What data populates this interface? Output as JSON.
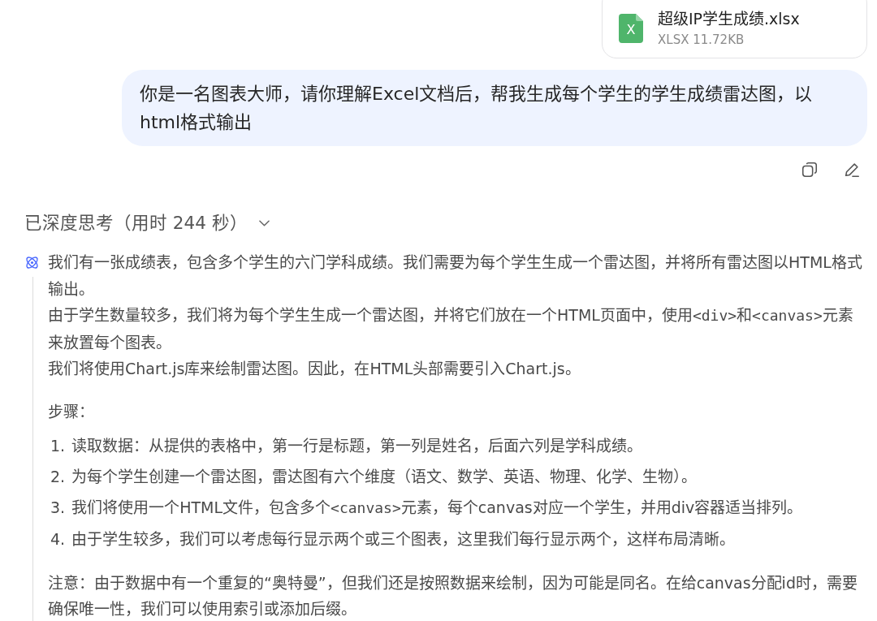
{
  "attachment": {
    "icon_letter": "X",
    "name": "超级IP学生成绩.xlsx",
    "meta": "XLSX 11.72KB"
  },
  "user_message": {
    "text": "你是一名图表大师，请你理解Excel文档后，帮我生成每个学生的学生成绩雷达图，以html格式输出"
  },
  "thinking": {
    "header": "已深度思考（用时 244 秒）",
    "expanded": true,
    "paragraphs": [
      {
        "segments": [
          {
            "kind": "text",
            "text": "我们有一张成绩表，包含多个学生的六门学科成绩。我们需要为每个学生生成一个雷达图，并将所有雷达图以HTML格式输出。"
          }
        ]
      },
      {
        "segments": [
          {
            "kind": "text",
            "text": "由于学生数量较多，我们将为每个学生生成一个雷达图，并将它们放在一个HTML页面中，使用"
          },
          {
            "kind": "code",
            "text": "<div>"
          },
          {
            "kind": "text",
            "text": "和"
          },
          {
            "kind": "code",
            "text": "<canvas>"
          },
          {
            "kind": "text",
            "text": "元素来放置每个图表。"
          }
        ]
      },
      {
        "segments": [
          {
            "kind": "text",
            "text": "我们将使用Chart.js库来绘制雷达图。因此，在HTML头部需要引入Chart.js。"
          }
        ]
      }
    ],
    "steps_title": "步骤：",
    "steps": [
      {
        "number": "1.",
        "segments": [
          {
            "kind": "text",
            "text": "读取数据：从提供的表格中，第一行是标题，第一列是姓名，后面六列是学科成绩。"
          }
        ]
      },
      {
        "number": "2.",
        "segments": [
          {
            "kind": "text",
            "text": "为每个学生创建一个雷达图，雷达图有六个维度（语文、数学、英语、物理、化学、生物）。"
          }
        ]
      },
      {
        "number": "3.",
        "segments": [
          {
            "kind": "text",
            "text": "我们将使用一个HTML文件，包含多个"
          },
          {
            "kind": "code",
            "text": "<canvas>"
          },
          {
            "kind": "text",
            "text": "元素，每个canvas对应一个学生，并用div容器适当排列。"
          }
        ]
      },
      {
        "number": "4.",
        "segments": [
          {
            "kind": "text",
            "text": "由于学生较多，我们可以考虑每行显示两个或三个图表，这里我们每行显示两个，这样布局清晰。"
          }
        ]
      }
    ],
    "note": "注意：由于数据中有一个重复的“奥特曼”，但我们还是按照数据来绘制，因为可能是同名。在给canvas分配id时，需要确保唯一性，我们可以使用索引或添加后缀。"
  }
}
